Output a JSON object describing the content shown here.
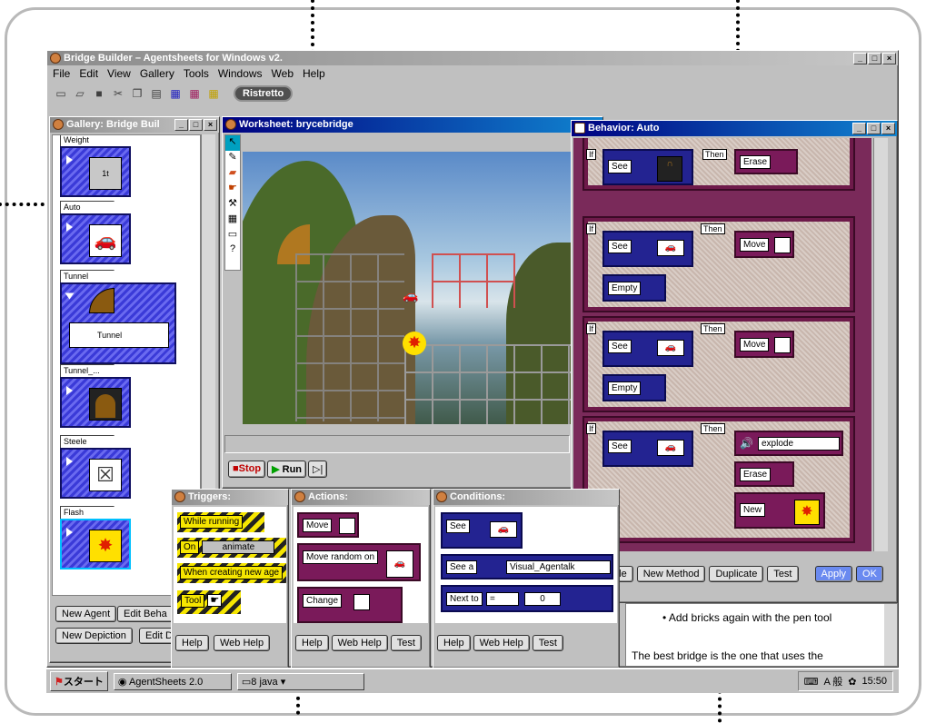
{
  "main_window": {
    "title": "Bridge Builder  –  Agentsheets for Windows v2.",
    "menus": [
      "File",
      "Edit",
      "View",
      "Gallery",
      "Tools",
      "Windows",
      "Web",
      "Help"
    ],
    "ristretto_label": "Ristretto"
  },
  "gallery": {
    "title": "Gallery: Bridge Buil",
    "items": [
      {
        "label": "Weight",
        "icon": "weight-icon"
      },
      {
        "label": "Auto",
        "icon": "car-icon"
      },
      {
        "label": "Tunnel",
        "icon": "tunnel-icon",
        "depiction": "Tunnel"
      },
      {
        "label": "Tunnel_...",
        "icon": "tunnel-arch-icon"
      },
      {
        "label": "Steele",
        "icon": "steel-girder-icon"
      },
      {
        "label": "Flash",
        "icon": "explosion-icon"
      }
    ],
    "buttons": {
      "new_agent": "New Agent",
      "edit_behavior": "Edit Beha",
      "new_depiction": "New Depiction",
      "edit_depiction": "Edit D"
    }
  },
  "worksheet": {
    "title": "Worksheet: brycebridge",
    "stop_label": "Stop",
    "run_label": "Run",
    "tools": [
      "arrow-icon",
      "pencil-icon",
      "eraser-icon",
      "hand-icon",
      "hammer-icon",
      "grid-icon",
      "rectangle-icon",
      "?"
    ]
  },
  "behavior": {
    "title": "Behavior: Auto",
    "if_label": "If",
    "then_label": "Then",
    "rules": [
      {
        "conditions": [
          "See"
        ],
        "actions": [
          "Erase"
        ]
      },
      {
        "conditions": [
          "See",
          "Empty"
        ],
        "actions": [
          "Move"
        ]
      },
      {
        "conditions": [
          "See",
          "Empty"
        ],
        "actions": [
          "Move"
        ]
      },
      {
        "conditions": [
          "See"
        ],
        "actions": [
          "explode",
          "Erase",
          "New"
        ]
      }
    ],
    "buttons": {
      "new_rule": "New Rule",
      "new_method": "New Method",
      "duplicate": "Duplicate",
      "test": "Test",
      "apply": "Apply",
      "ok": "OK"
    }
  },
  "triggers": {
    "title": "Triggers:",
    "items": [
      "While running",
      "On",
      "animate",
      "When creating new age",
      "Tool"
    ],
    "buttons": {
      "help": "Help",
      "web_help": "Web Help"
    }
  },
  "actions": {
    "title": "Actions:",
    "items": [
      "Move",
      "Move random on",
      "Change"
    ],
    "buttons": {
      "help": "Help",
      "web_help": "Web Help",
      "test": "Test"
    }
  },
  "conditions": {
    "title": "Conditions:",
    "items": [
      "See",
      "See a",
      "Visual_Agentalk",
      "Next to",
      "=",
      "0"
    ],
    "buttons": {
      "help": "Help",
      "web_help": "Web Help",
      "test": "Test"
    }
  },
  "help_text": {
    "line1": "Add bricks again with the pen tool",
    "line2": "The best bridge is the one that uses the"
  },
  "taskbar": {
    "start_label": "スタート",
    "app_label": "AgentSheets 2.0",
    "java_label": "8 java",
    "ime_label": "A 般",
    "clock": "15:50"
  },
  "colors": {
    "active_title": "#000080",
    "rule_frame": "#6e1a4a",
    "condition_blue": "#232391",
    "accent_yellow": "#f6e600"
  }
}
